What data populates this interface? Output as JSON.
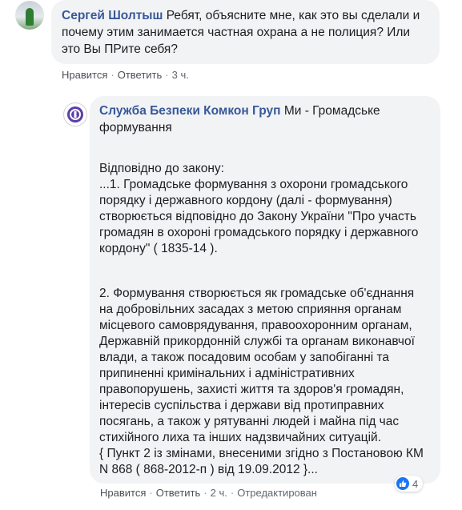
{
  "comment1": {
    "author": "Сергей Шолтыш",
    "text": "Ребят, объясните мне, как это вы сделали и почему этим занимается частная охрана а не полиция? Или это Вы ПРите себя?",
    "like_label": "Нравится",
    "reply_label": "Ответить",
    "time": "3 ч."
  },
  "comment2": {
    "author": "Служба Безпеки Комкон Груп",
    "intro": "Ми - Громадське формування",
    "paragraph1": "Відповідно до закону:\n...1. Громадське формування з охорони громадського порядку і державного кордону (далі - формування) створюється відповідно до Закону України \"Про участь громадян в охороні громадського порядку і державного кордону\" ( 1835-14 ).",
    "paragraph2": "2. Формування створюється як громадське об'єднання на добровільних засадах з метою сприяння органам місцевого самоврядування, правоохоронним органам, Державній прикордонній службі та органам виконавчої влади, а також посадовим особам у запобіганні та припиненні кримінальних і адміністративних правопорушень, захисті життя та здоров'я громадян, інтересів суспільства і держави від протиправних посягань, а також у рятуванні людей і майна під час стихійного лиха та інших надзвичайних ситуацій.\n{ Пункт 2 із змінами, внесеними згідно з Постановою КМ N 868 ( 868-2012-п ) від 19.09.2012 }...",
    "like_label": "Нравится",
    "reply_label": "Ответить",
    "time": "2 ч.",
    "edited_label": "Отредактирован",
    "reaction_count": "4"
  },
  "colors": {
    "author": "#385898",
    "bubble": "#f2f3f5",
    "like_badge": "#1877f2"
  }
}
